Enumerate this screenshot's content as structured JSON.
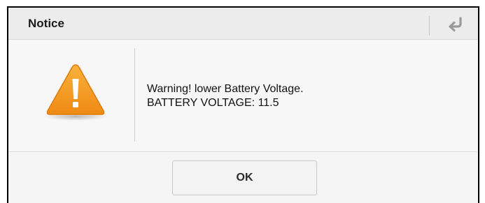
{
  "dialog": {
    "title": "Notice",
    "header_icon": "back-return-icon",
    "alert_icon": "warning-triangle-icon",
    "message_line1": "Warning! lower Battery Voltage.",
    "message_line2": "BATTERY VOLTAGE: 11.5",
    "ok_label": "OK"
  },
  "colors": {
    "warning_orange": "#f39a1d",
    "warning_orange_dark": "#e07a0b",
    "header_bg": "#ececec",
    "body_bg": "#f7f7f7"
  }
}
